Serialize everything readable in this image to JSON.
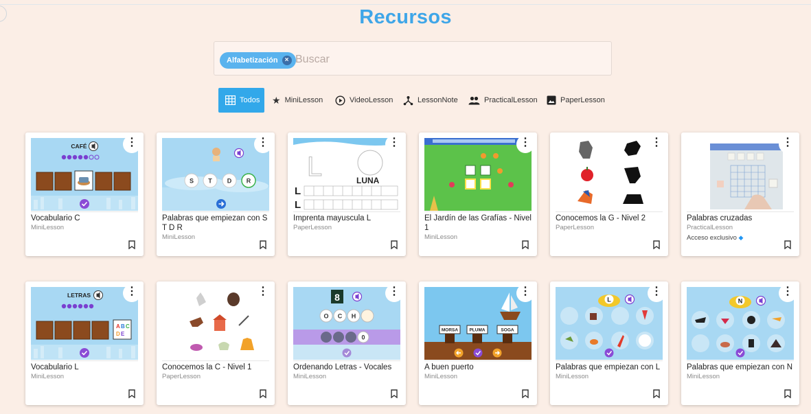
{
  "page": {
    "title": "Recursos"
  },
  "search": {
    "chip": "Alfabetización",
    "placeholder": "Buscar"
  },
  "filters": [
    {
      "label": "Todos",
      "icon": "grid-icon",
      "active": true
    },
    {
      "label": "MiniLesson",
      "icon": "star-icon"
    },
    {
      "label": "VideoLesson",
      "icon": "play-circle-icon"
    },
    {
      "label": "LessonNote",
      "icon": "network-icon"
    },
    {
      "label": "PracticalLesson",
      "icon": "people-icon"
    },
    {
      "label": "PaperLesson",
      "icon": "image-icon"
    }
  ],
  "cards": [
    {
      "title": "Vocabulario C",
      "type": "MiniLesson",
      "thumb_text": "CAFÉ"
    },
    {
      "title": "Palabras que empiezan con S T D R",
      "type": "MiniLesson",
      "thumb_letters": [
        "S",
        "T",
        "D",
        "R"
      ]
    },
    {
      "title": "Imprenta mayuscula L",
      "type": "PaperLesson",
      "thumb_text": "LUNA"
    },
    {
      "title": "El Jardín de las Grafías - Nivel 1",
      "type": "MiniLesson"
    },
    {
      "title": "Conocemos la G - Nivel 2",
      "type": "PaperLesson"
    },
    {
      "title": "Palabras cruzadas",
      "type": "PracticalLesson",
      "extra": "Acceso exclusivo"
    },
    {
      "title": "Vocabulario L",
      "type": "MiniLesson",
      "thumb_text": "LETRAS"
    },
    {
      "title": "Conocemos la C - Nivel 1",
      "type": "PaperLesson"
    },
    {
      "title": "Ordenando Letras - Vocales",
      "type": "MiniLesson",
      "thumb_letters": [
        "O",
        "C",
        "H"
      ]
    },
    {
      "title": "A buen puerto",
      "type": "MiniLesson",
      "thumb_words": [
        "MORSA",
        "PLUMA",
        "SOGA"
      ]
    },
    {
      "title": "Palabras que empiezan con L",
      "type": "MiniLesson",
      "thumb_letter": "L"
    },
    {
      "title": "Palabras que empiezan con N",
      "type": "MiniLesson",
      "thumb_letter": "N"
    }
  ],
  "colors": {
    "accent": "#32a8ea",
    "title": "#3fa6e8",
    "background": "#fbeee6"
  }
}
